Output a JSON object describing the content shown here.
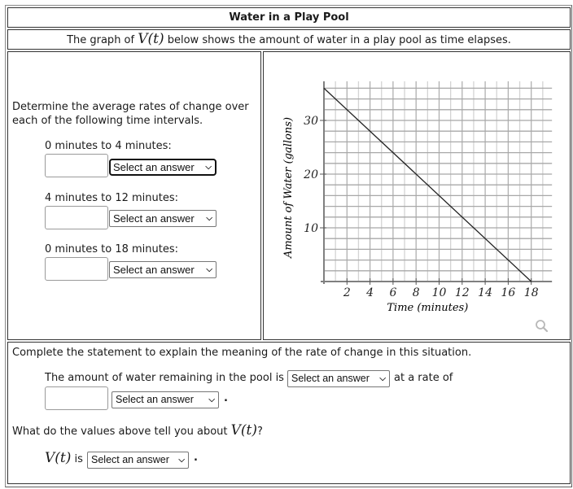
{
  "header": {
    "title": "Water in a Play Pool",
    "desc_prefix": "The graph of ",
    "desc_func": "V(t)",
    "desc_suffix": " below shows the amount of water in a play pool as time elapses."
  },
  "left_panel": {
    "instructions_line1": "Determine the average rates of change over",
    "instructions_line2": "each of the following time intervals.",
    "intervals": [
      {
        "label": "0 minutes to 4 minutes:",
        "input_value": "",
        "select_value": "Select an answer"
      },
      {
        "label": "4 minutes to 12 minutes:",
        "input_value": "",
        "select_value": "Select an answer"
      },
      {
        "label": "0 minutes to 18 minutes:",
        "input_value": "",
        "select_value": "Select an answer"
      }
    ]
  },
  "graph": {
    "magnifier_icon": "magnifier-icon"
  },
  "bottom_panel": {
    "prompt": "Complete the statement to explain the meaning of the rate of change in this situation.",
    "statement_prefix": "The amount of water remaining in the pool is",
    "statement_select": "Select an answer",
    "statement_suffix": "at a rate of",
    "rate_input_value": "",
    "rate_select": "Select an answer",
    "period": ".",
    "question_prefix": "What do the values above tell you about ",
    "question_func": "V(t)",
    "question_suffix": "?",
    "answer_func": "V(t)",
    "answer_is": "is",
    "answer_select": "Select an answer",
    "answer_period": "."
  },
  "chart_data": {
    "type": "line",
    "title": "",
    "xlabel": "Time (minutes)",
    "ylabel": "Amount of Water (gallons)",
    "xlim": [
      0,
      19
    ],
    "ylim": [
      0,
      37
    ],
    "x_ticks": [
      2,
      4,
      6,
      8,
      10,
      12,
      14,
      16,
      18
    ],
    "x_tick_labels": [
      "2",
      "4",
      "6",
      "8",
      "10",
      "12",
      "14",
      "16",
      "18"
    ],
    "y_ticks": [
      10,
      20,
      30
    ],
    "y_tick_labels": [
      "10",
      "20",
      "30"
    ],
    "x_grid_step": 1,
    "y_grid_step": 2,
    "grid": true,
    "series": [
      {
        "name": "V(t)",
        "x": [
          0,
          18
        ],
        "y": [
          36,
          0
        ]
      }
    ]
  }
}
